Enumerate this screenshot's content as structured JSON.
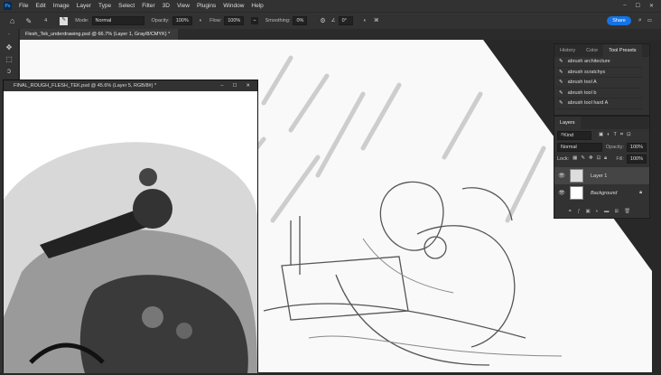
{
  "app": {
    "logo": "Ps"
  },
  "menu": [
    "File",
    "Edit",
    "Image",
    "Layer",
    "Type",
    "Select",
    "Filter",
    "3D",
    "View",
    "Plugins",
    "Window",
    "Help"
  ],
  "window_controls": [
    "–",
    "☐",
    "✕"
  ],
  "options": {
    "mode_label": "Mode:",
    "mode_value": "Normal",
    "opacity_label": "Opacity:",
    "opacity_value": "100%",
    "flow_label": "Flow:",
    "flow_value": "100%",
    "smoothing_label": "Smoothing:",
    "smoothing_value": "0%",
    "angle_value": "0°",
    "brush_size": "4",
    "share_label": "Share"
  },
  "document_tab": {
    "title": "Flesh_Tek_underdrawing.psd @ 66.7% (Layer 1, Gray/8/CMYK) *",
    "close": "×"
  },
  "floating_window": {
    "title": "FINAL_ROUGH_FLESH_TEK.psd @ 45.6% (Layer 5, RGB/8#) *"
  },
  "presets_panel": {
    "tabs": [
      "History",
      "Color",
      "Tool Presets"
    ],
    "active_tab": "Tool Presets",
    "items": [
      "abrush architecture",
      "abrush scratchys",
      "abrush tool A",
      "abrush tool b",
      "abrush tool hard A"
    ]
  },
  "layers_panel": {
    "title": "Layers",
    "filter": "Kind",
    "blend_mode": "Normal",
    "opacity_label": "Opacity:",
    "opacity_value": "100%",
    "lock_label": "Lock:",
    "fill_label": "Fill:",
    "fill_value": "100%",
    "layers": [
      {
        "name": "Layer 1",
        "selected": true
      },
      {
        "name": "Background",
        "locked": true
      }
    ]
  },
  "colors": {
    "share": "#1473e6",
    "canvas_bg": "#282828",
    "panel": "#323232"
  }
}
